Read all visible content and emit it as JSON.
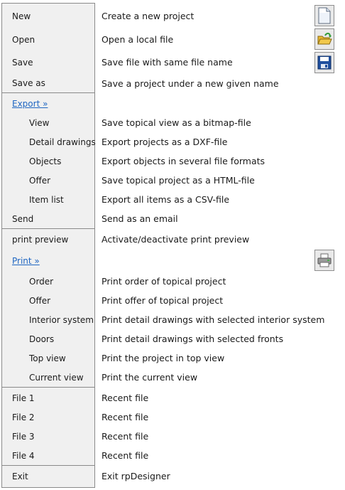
{
  "menu": {
    "new": "New",
    "open": "Open",
    "save": "Save",
    "save_as": "Save as",
    "export": "Export »",
    "view": "View",
    "detail_drawings": "Detail drawings",
    "objects": "Objects",
    "offer_export": "Offer",
    "item_list": "Item list",
    "send": "Send",
    "print_preview": "print preview",
    "print": "Print »",
    "order": "Order",
    "offer_print": "Offer",
    "interior_system": "Interior system",
    "doors": "Doors",
    "top_view": "Top view",
    "current_view": "Current view",
    "file1": "File 1",
    "file2": "File 2",
    "file3": "File 3",
    "file4": "File 4",
    "exit": "Exit"
  },
  "descriptions": {
    "new": "Create a new project",
    "open": "Open a local file",
    "save": "Save file with same file name",
    "save_as": "Save a project under a new given name",
    "view": "Save topical view as a bitmap-file",
    "detail_drawings": "Export projects as a DXF-file",
    "objects": "Export objects in several file formats",
    "offer_export": "Save topical project as a HTML-file",
    "item_list": "Export all items as a CSV-file",
    "send": "Send as an email",
    "print_preview": "Activate/deactivate print preview",
    "order": "Print order of topical project",
    "offer_print": "Print offer of topical project",
    "interior_system": "Print detail drawings with selected interior system",
    "doors": "Print detail drawings with selected fronts",
    "top_view": "Print the project in top view",
    "current_view": "Print the current view",
    "file1": "Recent file",
    "file2": "Recent file",
    "file3": "Recent file",
    "file4": "Recent file",
    "exit": "Exit rpDesigner"
  },
  "icons": {
    "new": "new-document-icon",
    "open": "open-folder-icon",
    "save": "floppy-disk-icon",
    "print": "printer-icon"
  },
  "colors": {
    "menu_bg": "#f0f0f0",
    "link": "#1f66c2",
    "border": "#8a8a8a",
    "save_blue": "#1f4f9e",
    "folder_yellow": "#f2c94c",
    "arrow_green": "#3aa63a"
  }
}
